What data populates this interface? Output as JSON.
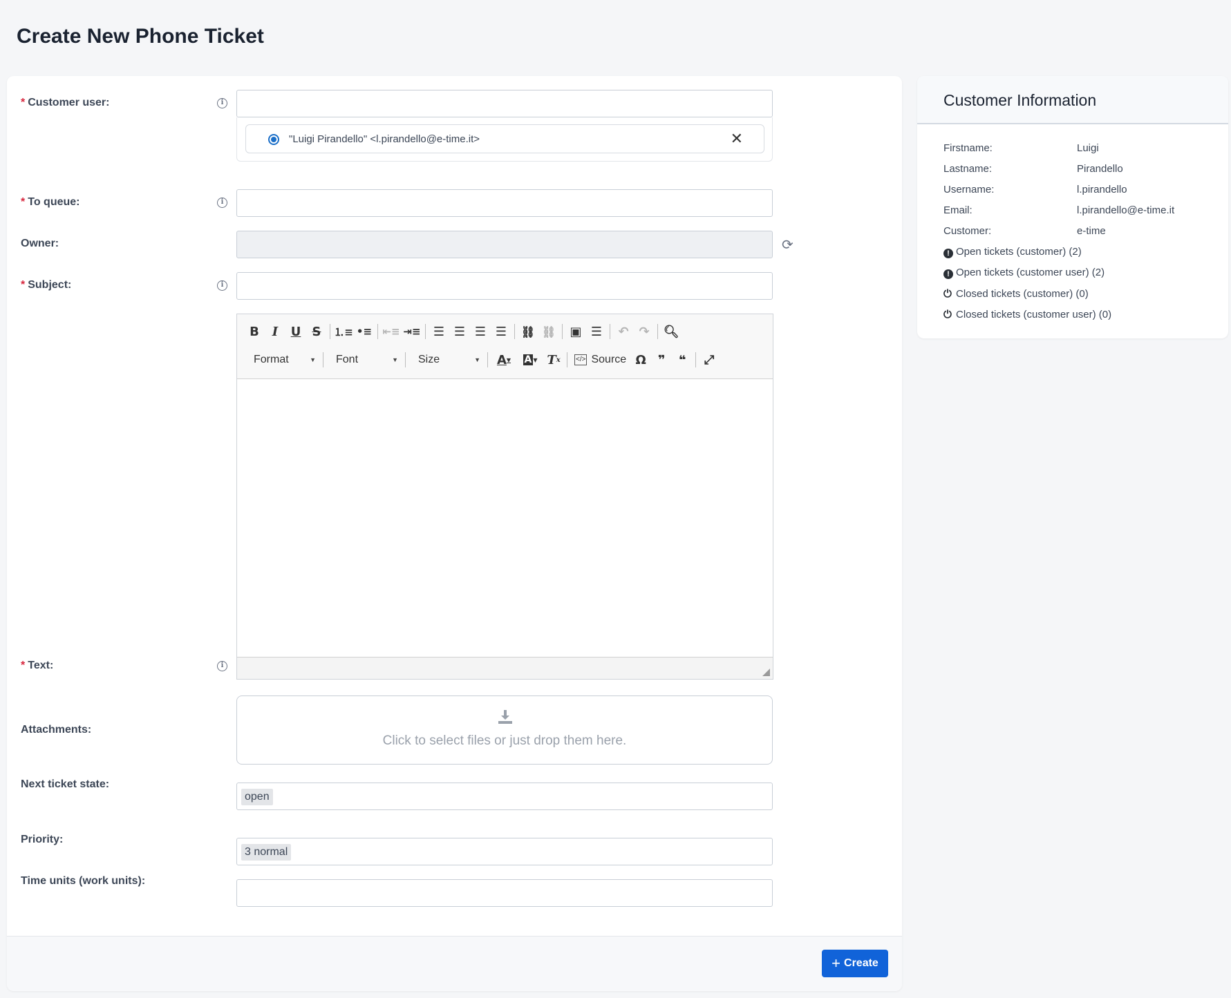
{
  "page": {
    "title": "Create New Phone Ticket"
  },
  "form": {
    "customer_user": {
      "label": "Customer user:",
      "value": "",
      "selected": "\"Luigi Pirandello\" <l.pirandello@e-time.it>"
    },
    "to_queue": {
      "label": "To queue:",
      "value": ""
    },
    "owner": {
      "label": "Owner:",
      "value": ""
    },
    "subject": {
      "label": "Subject:",
      "value": ""
    },
    "text": {
      "label": "Text:"
    },
    "attachments": {
      "label": "Attachments:",
      "dropzone_text": "Click to select files or just drop them here."
    },
    "next_state": {
      "label": "Next ticket state:",
      "value": "open"
    },
    "priority": {
      "label": "Priority:",
      "value": "3 normal"
    },
    "time_units": {
      "label": "Time units (work units):",
      "value": ""
    },
    "required_mark": "*"
  },
  "editor": {
    "format_label": "Format",
    "font_label": "Font",
    "size_label": "Size",
    "source_label": "Source"
  },
  "actions": {
    "create_label": "Create"
  },
  "customer_info": {
    "title": "Customer Information",
    "fields": [
      {
        "key": "Firstname:",
        "value": "Luigi"
      },
      {
        "key": "Lastname:",
        "value": "Pirandello"
      },
      {
        "key": "Username:",
        "value": "l.pirandello"
      },
      {
        "key": "Email:",
        "value": "l.pirandello@e-time.it"
      },
      {
        "key": "Customer:",
        "value": "e-time"
      }
    ],
    "links": [
      "Open tickets (customer) (2)",
      "Open tickets (customer user) (2)",
      "Closed tickets (customer) (0)",
      "Closed tickets (customer user) (0)"
    ]
  },
  "colors": {
    "accent": "#1163d9",
    "required": "#d7263d"
  }
}
